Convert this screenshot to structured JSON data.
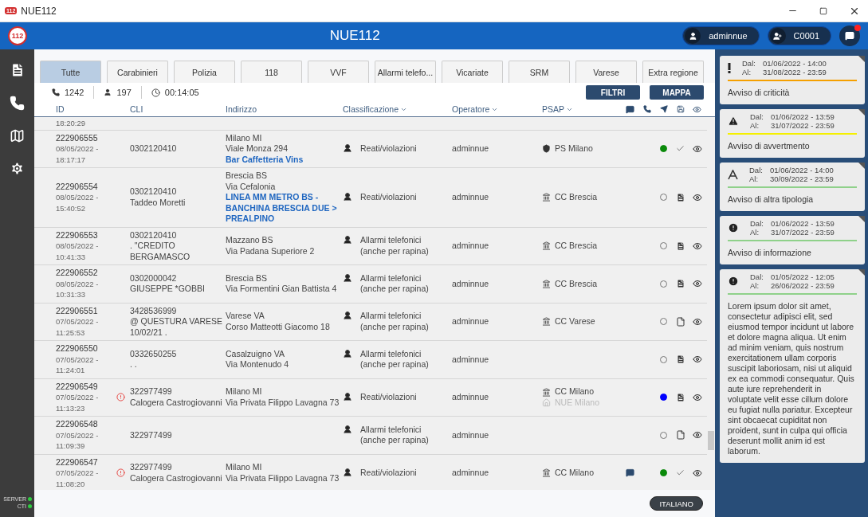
{
  "window": {
    "logo": "112",
    "title": "NUE112"
  },
  "appbar": {
    "logo": "112",
    "title": "NUE112",
    "user": "adminnue",
    "station": "C0001",
    "unread": true
  },
  "sidebar": {
    "status": [
      {
        "label": "SERVER",
        "online": true
      },
      {
        "label": "CTI",
        "online": true
      }
    ]
  },
  "tabs": [
    {
      "label": "Tutte",
      "selected": true
    },
    {
      "label": "Carabinieri",
      "selected": false
    },
    {
      "label": "Polizia",
      "selected": false
    },
    {
      "label": "118",
      "selected": false
    },
    {
      "label": "VVF",
      "selected": false
    },
    {
      "label": "Allarmi telefo...",
      "selected": false
    },
    {
      "label": "Vicariate",
      "selected": false
    },
    {
      "label": "SRM",
      "selected": false
    },
    {
      "label": "Varese",
      "selected": false
    },
    {
      "label": "Extra regione",
      "selected": false
    }
  ],
  "stats": {
    "calls": "1242",
    "users": "197",
    "elapsed": "00:14:05"
  },
  "actions": [
    "FILTRI",
    "MAPPA"
  ],
  "table": {
    "columns": [
      {
        "label": "ID",
        "sortable": false
      },
      {
        "label": "CLI",
        "sortable": false
      },
      {
        "label": "Indirizzo",
        "sortable": false
      },
      {
        "label": "Classificazione",
        "sortable": true
      },
      {
        "label": "Operatore",
        "sortable": true
      },
      {
        "label": "PSAP",
        "sortable": true
      }
    ],
    "rows": [
      {
        "kind": "partial",
        "time": "18:20:29"
      },
      {
        "kind": "full",
        "id": "222906555",
        "date": "08/05/2022 -",
        "time": "18:17:17",
        "alert": false,
        "cli": [
          "0302120410"
        ],
        "address": [
          {
            "text": "Milano MI",
            "kind": "plain"
          },
          {
            "text": "Viale Monza 294",
            "kind": "plain"
          },
          {
            "text": "Bar Caffetteria Vins",
            "kind": "place"
          }
        ],
        "classification": "Reati/violazioni",
        "operator": "adminnue",
        "psap": [
          {
            "name": "PS Milano",
            "kind": "police",
            "active": true
          }
        ],
        "message": false,
        "dot": {
          "filled": true,
          "color": "#0a8a0a"
        },
        "report": {
          "kind": "check"
        }
      },
      {
        "kind": "full",
        "id": "222906554",
        "date": "08/05/2022 -",
        "time": "15:40:52",
        "alert": false,
        "cli": [
          "0302120410",
          "Taddeo Moretti"
        ],
        "address": [
          {
            "text": "Brescia BS",
            "kind": "plain"
          },
          {
            "text": "Via Cefalonia",
            "kind": "plain"
          },
          {
            "text": "LINEA MM METRO BS - BANCHINA BRESCIA DUE > PREALPINO",
            "kind": "place"
          }
        ],
        "classification": "Reati/violazioni",
        "operator": "adminnue",
        "psap": [
          {
            "name": "CC Brescia",
            "kind": "carabinieri",
            "active": true
          }
        ],
        "message": false,
        "dot": {
          "filled": false
        },
        "report": {
          "kind": "document-filled"
        }
      },
      {
        "kind": "full",
        "id": "222906553",
        "date": "08/05/2022 -",
        "time": "10:41:33",
        "alert": false,
        "cli": [
          "0302120410",
          ". \"CREDITO BERGAMASCO"
        ],
        "address": [
          {
            "text": "Mazzano BS",
            "kind": "plain"
          },
          {
            "text": "Via Padana Superiore 2",
            "kind": "plain"
          }
        ],
        "classification": "Allarmi telefonici (anche per rapina)",
        "operator": "adminnue",
        "psap": [
          {
            "name": "CC Brescia",
            "kind": "carabinieri",
            "active": true
          }
        ],
        "message": false,
        "dot": {
          "filled": false
        },
        "report": {
          "kind": "document-filled"
        }
      },
      {
        "kind": "full",
        "id": "222906552",
        "date": "08/05/2022 -",
        "time": "10:31:33",
        "alert": false,
        "cli": [
          "0302000042",
          "GIUSEPPE *GOBBI"
        ],
        "address": [
          {
            "text": "Brescia BS",
            "kind": "plain"
          },
          {
            "text": "Via Formentini Gian Battista 4",
            "kind": "plain"
          }
        ],
        "classification": "Allarmi telefonici (anche per rapina)",
        "operator": "adminnue",
        "psap": [
          {
            "name": "CC Brescia",
            "kind": "carabinieri",
            "active": true
          }
        ],
        "message": false,
        "dot": {
          "filled": false
        },
        "report": {
          "kind": "document-filled"
        }
      },
      {
        "kind": "full",
        "id": "222906551",
        "date": "07/05/2022 -",
        "time": "11:25:53",
        "alert": false,
        "cli": [
          "3428536999",
          "@ QUESTURA VARESE",
          "10/02/21 ."
        ],
        "address": [
          {
            "text": "Varese VA",
            "kind": "plain"
          },
          {
            "text": "Corso Matteotti Giacomo 18",
            "kind": "plain"
          }
        ],
        "classification": "Allarmi telefonici (anche per rapina)",
        "operator": "adminnue",
        "psap": [
          {
            "name": "CC Varese",
            "kind": "carabinieri",
            "active": true
          }
        ],
        "message": false,
        "dot": {
          "filled": false
        },
        "report": {
          "kind": "document-empty"
        }
      },
      {
        "kind": "full",
        "id": "222906550",
        "date": "07/05/2022 -",
        "time": "11:24:01",
        "alert": false,
        "cli": [
          "0332650255",
          ". ."
        ],
        "address": [
          {
            "text": "Casalzuigno VA",
            "kind": "plain"
          },
          {
            "text": "Via Montenudo 4",
            "kind": "plain"
          }
        ],
        "classification": "Allarmi telefonici (anche per rapina)",
        "operator": "adminnue",
        "psap": [],
        "message": false,
        "dot": {
          "filled": false
        },
        "report": {
          "kind": "document-filled"
        }
      },
      {
        "kind": "full",
        "id": "222906549",
        "date": "07/05/2022 -",
        "time": "11:13:23",
        "alert": true,
        "cli": [
          "322977499",
          "Calogera Castrogiovanni"
        ],
        "address": [
          {
            "text": "Milano MI",
            "kind": "plain"
          },
          {
            "text": "Via Privata Filippo Lavagna 73",
            "kind": "plain"
          }
        ],
        "classification": "Reati/violazioni",
        "operator": "adminnue",
        "psap": [
          {
            "name": "CC Milano",
            "kind": "carabinieri",
            "active": true
          },
          {
            "name": "NUE Milano",
            "kind": "nue",
            "active": false
          }
        ],
        "message": false,
        "dot": {
          "filled": true,
          "color": "#0000ff"
        },
        "report": {
          "kind": "document-filled"
        }
      },
      {
        "kind": "full",
        "id": "222906548",
        "date": "07/05/2022 -",
        "time": "11:09:39",
        "alert": false,
        "cli": [
          "322977499"
        ],
        "address": [],
        "classification": "Allarmi telefonici (anche per rapina)",
        "operator": "adminnue",
        "psap": [],
        "message": false,
        "dot": {
          "filled": false
        },
        "report": {
          "kind": "document-empty"
        }
      },
      {
        "kind": "full",
        "id": "222906547",
        "date": "07/05/2022 -",
        "time": "11:08:20",
        "alert": true,
        "cli": [
          "322977499",
          "Calogera Castrogiovanni"
        ],
        "address": [
          {
            "text": "Milano MI",
            "kind": "plain"
          },
          {
            "text": "Via Privata Filippo Lavagna 73",
            "kind": "plain"
          }
        ],
        "classification": "Reati/violazioni",
        "operator": "adminnue",
        "psap": [
          {
            "name": "CC Milano",
            "kind": "carabinieri",
            "active": true
          }
        ],
        "message": true,
        "dot": {
          "filled": true,
          "color": "#0a8a0a"
        },
        "report": {
          "kind": "check"
        }
      }
    ]
  },
  "language": "ITALIANO",
  "notices": [
    {
      "kind": "critical",
      "color": "#f5a000",
      "from_label": "Dal:",
      "from": "01/06/2022 - 14:00",
      "to_label": "Al:",
      "to": "31/08/2022 - 23:59",
      "text": "Avviso di criticità"
    },
    {
      "kind": "warning",
      "color": "#f5f000",
      "from_label": "Dal:",
      "from": "01/06/2022 - 13:59",
      "to_label": "Al:",
      "to": "31/07/2022 - 23:59",
      "text": "Avviso di avvertmento"
    },
    {
      "kind": "other",
      "color": "#8fd18a",
      "from_label": "Dal:",
      "from": "01/06/2022 - 14:00",
      "to_label": "Al:",
      "to": "30/09/2022 - 23:59",
      "text": "Avviso di altra tipologia"
    },
    {
      "kind": "info",
      "color": "#8fd18a",
      "from_label": "Dal:",
      "from": "01/06/2022 - 13:59",
      "to_label": "Al:",
      "to": "31/07/2022 - 23:59",
      "text": "Avviso di informazione"
    },
    {
      "kind": "info",
      "color": "#8fd18a",
      "from_label": "Dal:",
      "from": "01/05/2022 - 12:05",
      "to_label": "Al:",
      "to": "26/06/2022 - 23:59",
      "text": "Lorem ipsum dolor sit amet, consectetur adipisci elit, sed eiusmod tempor incidunt ut labore et dolore magna aliqua. Ut enim ad minim veniam, quis nostrum exercitationem ullam corporis suscipit laboriosam, nisi ut aliquid ex ea commodi consequatur. Quis aute iure reprehenderit in voluptate velit esse cillum dolore eu fugiat nulla pariatur. Excepteur sint obcaecat cupiditat non proident, sunt in culpa qui officia deserunt mollit anim id est laborum."
    }
  ]
}
